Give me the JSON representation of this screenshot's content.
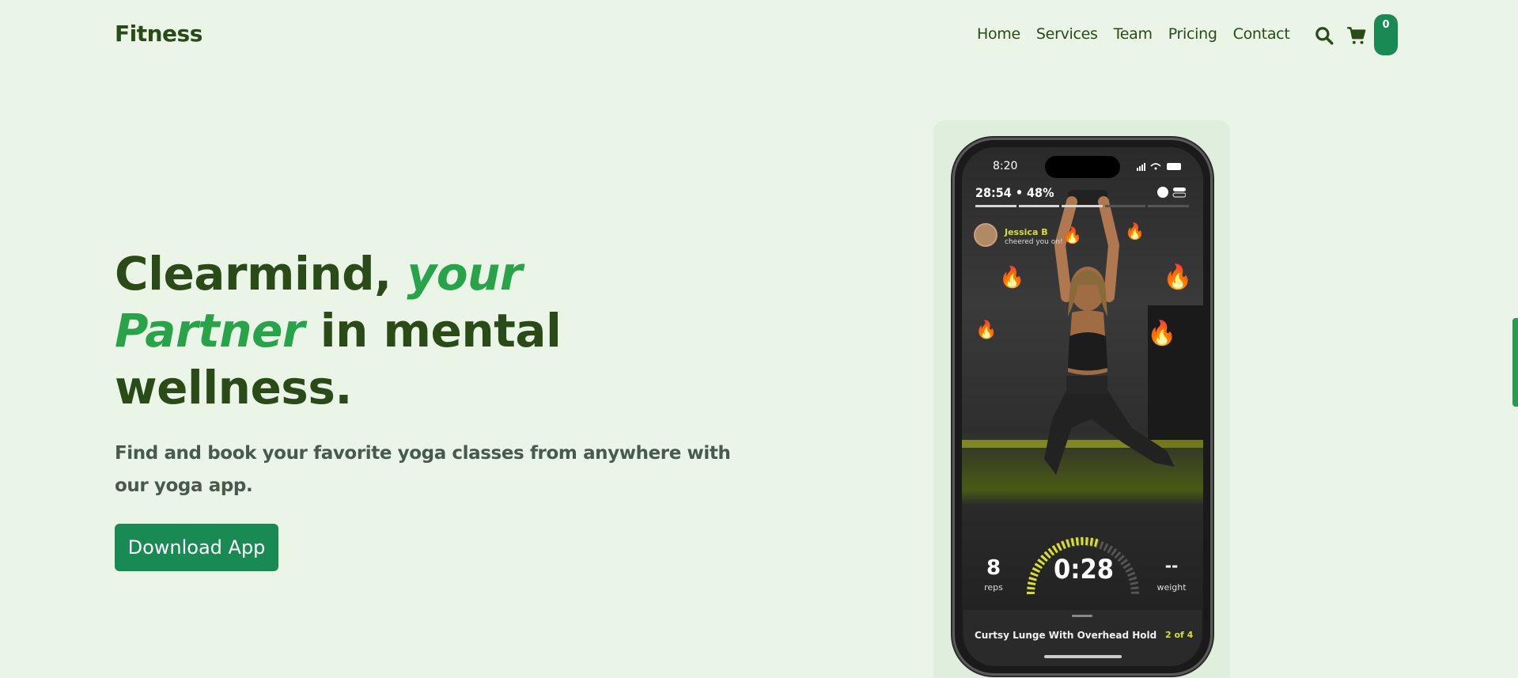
{
  "nav": {
    "brand": "Fitness",
    "links": [
      "Home",
      "Services",
      "Team",
      "Pricing",
      "Contact"
    ],
    "search_icon": "search-icon",
    "cart_icon": "cart-icon",
    "cart_count": "0"
  },
  "hero": {
    "title_part1": "Clearmind, ",
    "title_accent1": "your",
    "title_accent2": "Partner",
    "title_part2": " in mental",
    "title_part3": "wellness.",
    "subtitle": "Find and book your favorite yoga classes from anywhere with our yoga app.",
    "cta": "Download App"
  },
  "phone": {
    "status_time": "8:20",
    "workout_stats": "28:54 • 48%",
    "cheer_name": "Jessica B",
    "cheer_text": "cheered you on!",
    "reps_value": "8",
    "reps_label": "reps",
    "timer": "0:28",
    "weight_value": "--",
    "weight_label": "weight",
    "exercise_name": "Curtsy Lunge With Overhead Hold",
    "exercise_count": "2 of 4"
  },
  "colors": {
    "background": "#eaf5e8",
    "brand_text": "#2a4a18",
    "accent": "#28a34a",
    "button": "#1a8a55",
    "highlight": "#d6e02a"
  }
}
